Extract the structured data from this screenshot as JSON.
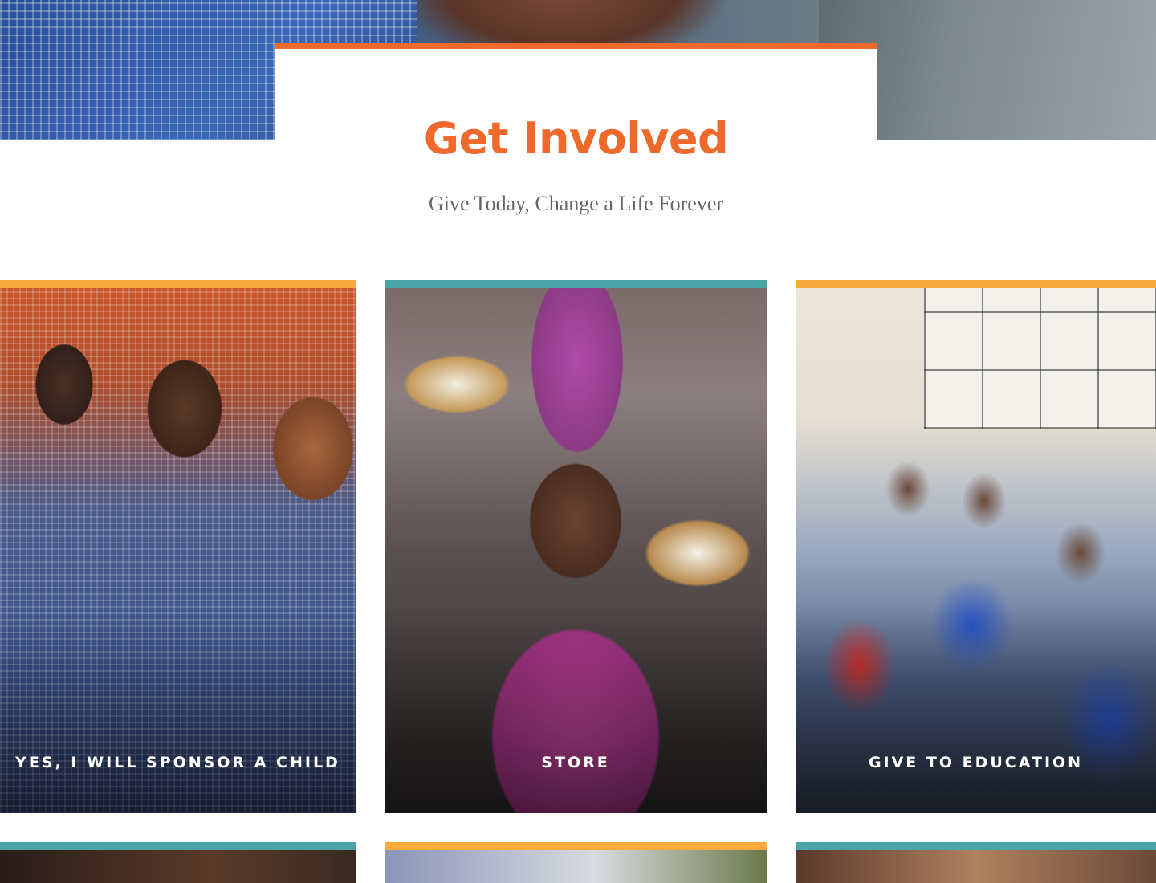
{
  "section": {
    "title": "Get Involved",
    "subtitle": "Give Today, Change a Life Forever"
  },
  "cards": [
    {
      "label": "YES, I WILL SPONSOR A CHILD",
      "accent": "#f7a93b"
    },
    {
      "label": "STORE",
      "accent": "#4aa3a6"
    },
    {
      "label": "GIVE TO EDUCATION",
      "accent": "#f7a93b"
    }
  ],
  "colors": {
    "title": "#ee6a2c",
    "orange_accent": "#f7a93b",
    "teal_accent": "#4aa3a6"
  }
}
